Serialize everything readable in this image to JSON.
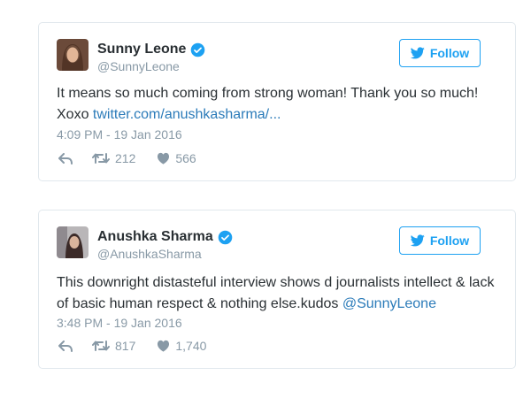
{
  "tweets": [
    {
      "name": "Sunny Leone",
      "handle": "@SunnyLeone",
      "follow_label": "Follow",
      "text": "It means so much coming from strong woman! Thank you so much! Xoxo ",
      "link": "twitter.com/anushkasharma/...",
      "time": "4:09 PM - 19 Jan 2016",
      "retweets": "212",
      "likes": "566"
    },
    {
      "name": "Anushka Sharma",
      "handle": "@AnushkaSharma",
      "follow_label": "Follow",
      "text": "This downright distasteful interview shows d journalists intellect & lack of basic human respect & nothing else.kudos ",
      "link": "@SunnyLeone",
      "time": "3:48 PM - 19 Jan 2016",
      "retweets": "817",
      "likes": "1,740"
    }
  ],
  "colors": {
    "accent": "#1da1f2",
    "link": "#2b7bb9",
    "muted": "#8899a6",
    "text": "#292f33",
    "border": "#e1e8ed"
  }
}
